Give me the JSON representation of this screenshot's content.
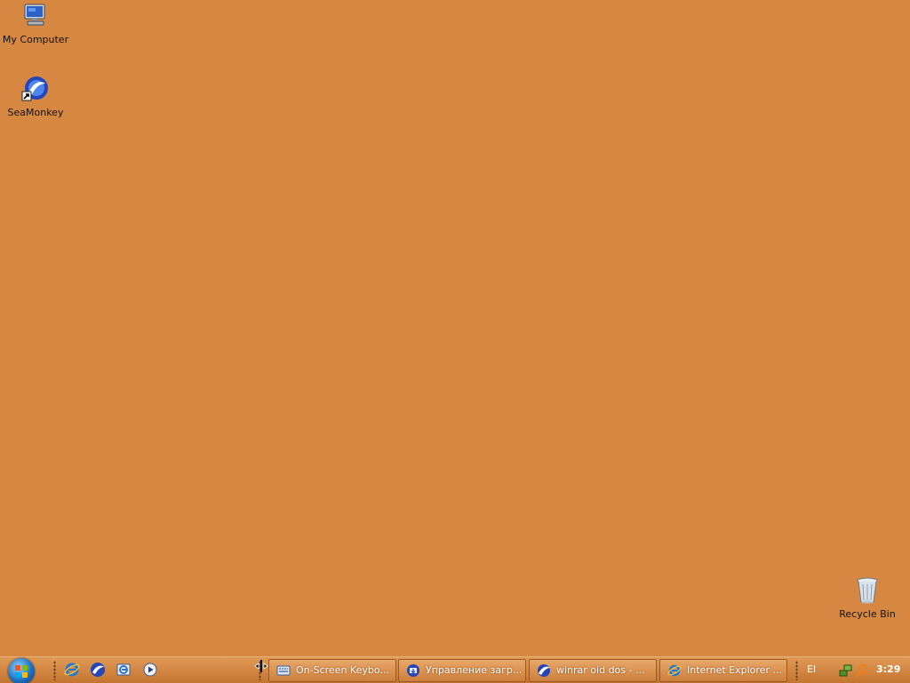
{
  "desktop": {
    "background_color": "#d68842",
    "icons": [
      {
        "label": "My Computer",
        "icon": "my-computer-icon"
      },
      {
        "label": "SeaMonkey",
        "icon": "seamonkey-icon",
        "shortcut": true
      },
      {
        "label": "Recycle Bin",
        "icon": "recycle-bin-icon"
      }
    ]
  },
  "taskbar": {
    "start_button": {
      "icon": "windows-start-orb-icon"
    },
    "quick_launch": [
      {
        "icon": "internet-explorer-icon"
      },
      {
        "icon": "seamonkey-icon"
      },
      {
        "icon": "show-desktop-icon"
      },
      {
        "icon": "media-player-icon"
      }
    ],
    "tasks": [
      {
        "label": "On-Screen Keybo...",
        "icon": "keyboard-icon"
      },
      {
        "label": "Управление загр...",
        "icon": "download-manager-icon"
      },
      {
        "label": "winrar oid dos - ...",
        "icon": "seamonkey-icon"
      },
      {
        "label": "Internet Explorer ...",
        "icon": "internet-explorer-icon"
      }
    ],
    "tray": {
      "language": "El",
      "icons": [
        "network-icon",
        "search-icon"
      ],
      "clock": "3:29"
    }
  }
}
